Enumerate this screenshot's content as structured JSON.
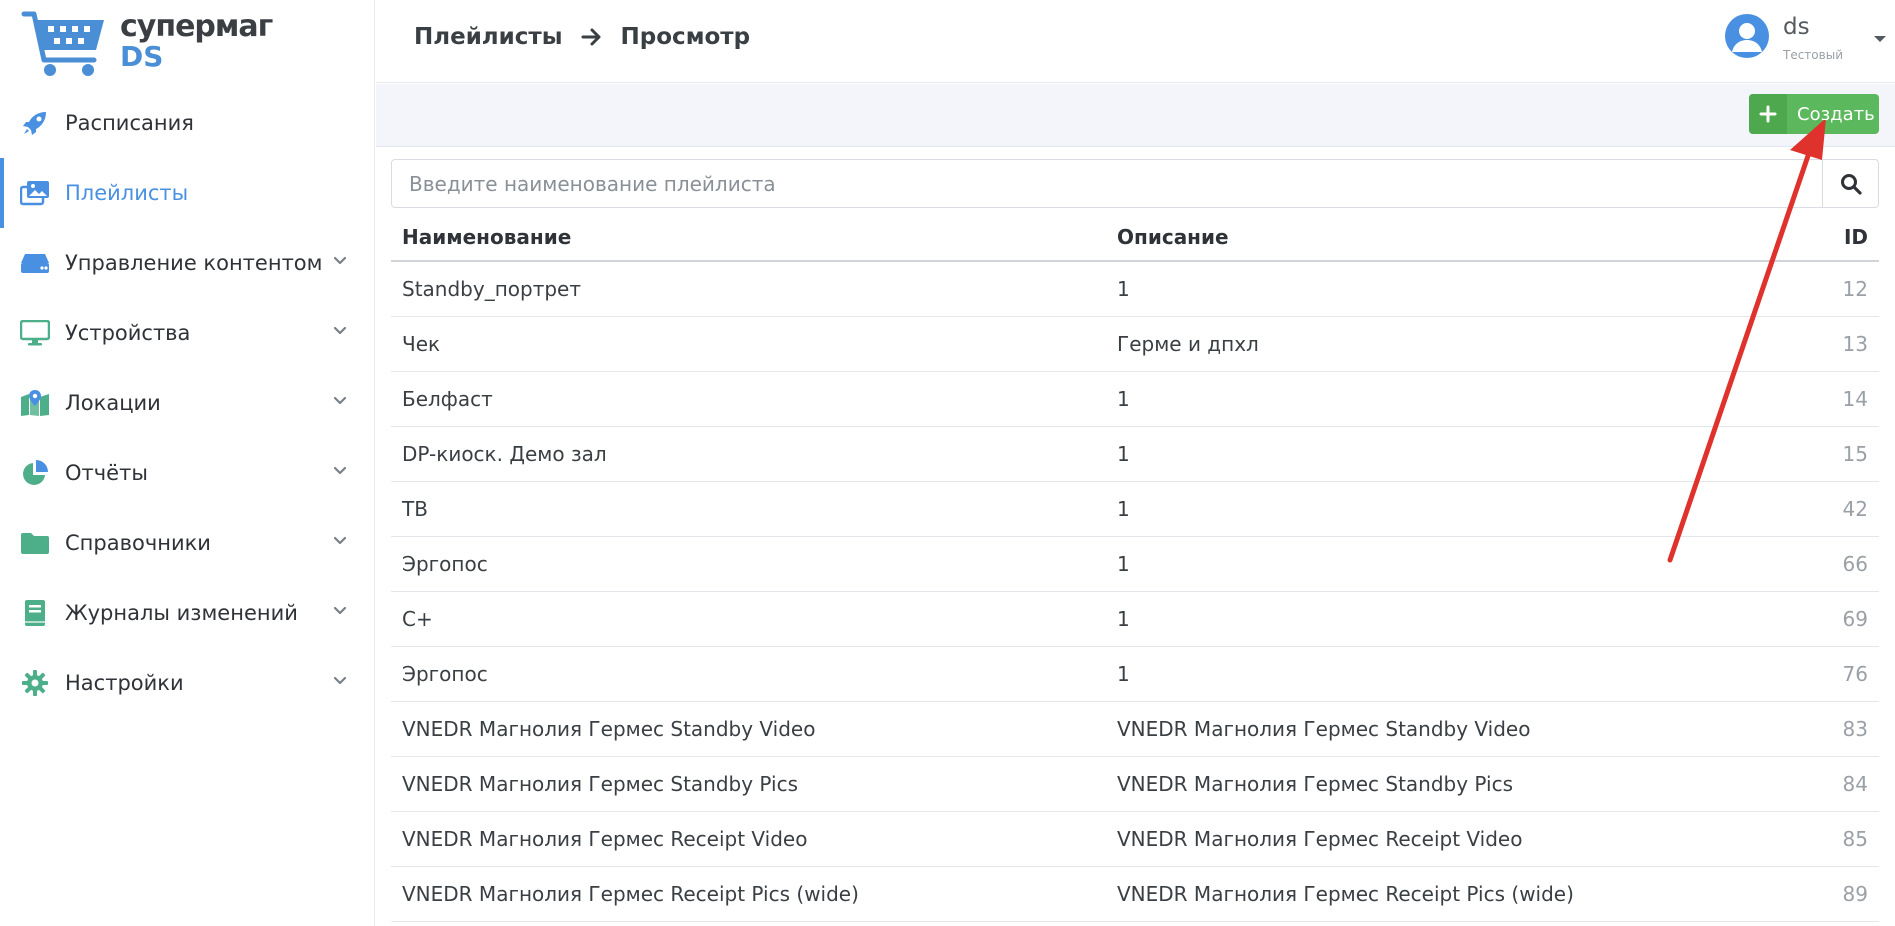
{
  "logo": {
    "line1": "супермаг",
    "line2": "DS"
  },
  "sidebar": {
    "items": [
      {
        "label": "Расписания",
        "icon": "rocket-icon",
        "active": false,
        "expandable": false
      },
      {
        "label": "Плейлисты",
        "icon": "images-icon",
        "active": true,
        "expandable": false
      },
      {
        "label": "Управление контентом",
        "icon": "hdd-icon",
        "active": false,
        "expandable": true
      },
      {
        "label": "Устройства",
        "icon": "monitor-icon",
        "active": false,
        "expandable": true
      },
      {
        "label": "Локации",
        "icon": "map-icon",
        "active": false,
        "expandable": true
      },
      {
        "label": "Отчёты",
        "icon": "pie-chart-icon",
        "active": false,
        "expandable": true
      },
      {
        "label": "Справочники",
        "icon": "folder-icon",
        "active": false,
        "expandable": true
      },
      {
        "label": "Журналы изменений",
        "icon": "book-icon",
        "active": false,
        "expandable": true
      },
      {
        "label": "Настройки",
        "icon": "gear-icon",
        "active": false,
        "expandable": true
      }
    ]
  },
  "header": {
    "breadcrumb": [
      "Плейлисты",
      "Просмотр"
    ],
    "user": {
      "name": "ds",
      "role": "Тестовый"
    }
  },
  "toolbar": {
    "create_label": "Создать"
  },
  "search": {
    "placeholder": "Введите наименование плейлиста",
    "value": ""
  },
  "table": {
    "columns": [
      "Наименование",
      "Описание",
      "ID"
    ],
    "rows": [
      [
        "Standby_портрет",
        "1",
        "12"
      ],
      [
        "Чек",
        "Герме и дпхл",
        "13"
      ],
      [
        "Белфаст",
        "1",
        "14"
      ],
      [
        "DP-киоск. Демо зал",
        "1",
        "15"
      ],
      [
        "ТВ",
        "1",
        "42"
      ],
      [
        "Эргопос",
        "1",
        "66"
      ],
      [
        "С+",
        "1",
        "69"
      ],
      [
        "Эргопос",
        "1",
        "76"
      ],
      [
        "VNEDR Магнолия Гермес Standby Video",
        "VNEDR Магнолия Гермес Standby Video",
        "83"
      ],
      [
        "VNEDR Магнолия Гермес Standby Pics",
        "VNEDR Магнолия Гермес Standby Pics",
        "84"
      ],
      [
        "VNEDR Магнолия Гермес Receipt Video",
        "VNEDR Магнолия Гермес Receipt Video",
        "85"
      ],
      [
        "VNEDR Магнолия Гермес Receipt Pics (wide)",
        "VNEDR Магнолия Гермес Receipt Pics (wide)",
        "89"
      ]
    ]
  },
  "colors": {
    "accent": "#4a90e2",
    "icon_green": "#4caf8a",
    "create_button": "#5cb85c",
    "annotation_arrow": "#e0322c"
  }
}
